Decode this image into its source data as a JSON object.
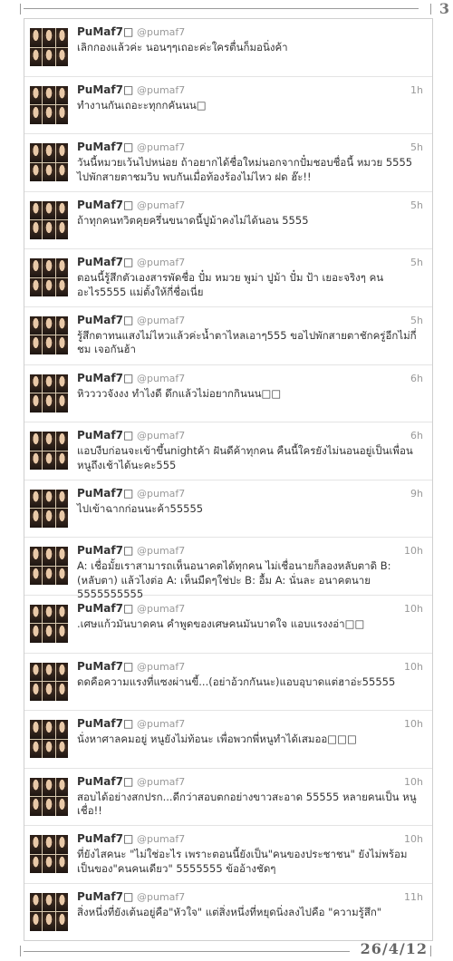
{
  "page": {
    "number": "3",
    "date": "26/4/12"
  },
  "tweets": [
    {
      "name": "PuMaf7□",
      "handle": "@pumaf7",
      "time": "",
      "text": "เลิกกองแล้วค่ะ นอนๆๆเถอะค่ะใครตื่นก็มอนิ่งค้า"
    },
    {
      "name": "PuMaf7□",
      "handle": "@pumaf7",
      "time": "1h",
      "text": "ทำงานกันเถอะะทุกกคันนน□"
    },
    {
      "name": "PuMaf7□",
      "handle": "@pumaf7",
      "time": "5h",
      "text": "วันนี้หมวยเว้นไปหน่อย ถ้าอยากได้ชื่อใหม่นอกจากปั๋มชอบชื่อนี้ หมวย 5555 ไปพักสายตาชมวิบ พบกันเมื่อท้องร้องไม่ไหว ฝด ฮ๊ะ!!"
    },
    {
      "name": "PuMaf7□",
      "handle": "@pumaf7",
      "time": "5h",
      "text": "ถ้าทุกคนทวิตคุยครึ่นขนาดนี้ปูม้าคงไม่ได้นอน 5555"
    },
    {
      "name": "PuMaf7□",
      "handle": "@pumaf7",
      "time": "5h",
      "text": "ตอนนี้รู้สึกตัวเองสารพัดชื่อ ปั๋ม หมวย พูม่า ปูม้า ปั๋ม ป้า เยอะจริงๆ คน อะไร5555 แม่ตั้งให้กี่ชื่อเนี่ย"
    },
    {
      "name": "PuMaf7□",
      "handle": "@pumaf7",
      "time": "5h",
      "text": "รู้สึกตาทนแสงไม่ไหวแล้วค่ะน้ำตาไหลเอาๆ555 ขอไปพักสายตาชักครู่อีกไม่กี่ ชม เจอกันฮ้า"
    },
    {
      "name": "PuMaf7□",
      "handle": "@pumaf7",
      "time": "6h",
      "text": "หิววววจังงง ทำไงดี ดึกแล้วไม่อยากกินนน□□"
    },
    {
      "name": "PuMaf7□",
      "handle": "@pumaf7",
      "time": "6h",
      "text": "แอบงีบก่อนจะเข้าขึ้นnightค้า ฝันดีค้าทุกคน คืนนี้ใครยังไม่นอนอยู่เป็นเพื่อน หนูถึงเช้าได้นะคะ555"
    },
    {
      "name": "PuMaf7□",
      "handle": "@pumaf7",
      "time": "9h",
      "text": "ไปเข้าฉากก่อนนะค้า55555"
    },
    {
      "name": "PuMaf7□",
      "handle": "@pumaf7",
      "time": "10h",
      "text": "A: เชื่อมั้ยเราสามารถเห็นอนาคตได้ทุกคน ไม่เชื่อนายก็ลองหลับตาดิ B: (หลับตา) แล้วไงต่อ A: เห็นมืดๆใช่ปะ B: อื้ม A: นั่นละ อนาคตนาย 5555555555"
    },
    {
      "name": "PuMaf7□",
      "handle": "@pumaf7",
      "time": "10h",
      "text": ".เศษแก้วมันบาดคน คำพูดของเศษคนมันบาดใจ แอบแรงงอ่า□□"
    },
    {
      "name": "PuMaf7□",
      "handle": "@pumaf7",
      "time": "10h",
      "text": "ดดคือความแรงที่แซงผ่านขี้...(อย่าอ้วกกันนะ)แอบอุบาดแต่ฮาอ่ะ55555"
    },
    {
      "name": "PuMaf7□",
      "handle": "@pumaf7",
      "time": "10h",
      "text": "นั่งหาศาลคมอยู่ หนูยังไม่ท้อนะ เพื่อพวกพี่หนูทำได้เสมออ□□□"
    },
    {
      "name": "PuMaf7□",
      "handle": "@pumaf7",
      "time": "10h",
      "text": "สอบได้อย่างสกปรก...ดีกว่าสอบตกอย่างขาวสะอาด 55555 หลายคนเป็น หนูเชื่อ!!"
    },
    {
      "name": "PuMaf7□",
      "handle": "@pumaf7",
      "time": "10h",
      "text": "ที่ยังไสคนะ \"ไม่ใช่อะไร เพราะตอนนี้ยังเป็น\"คนของประชาชน\" ยังไม่พร้อมเป็นของ\"คนคนเดียว\" 5555555 ข้ออ้างชัดๆ"
    },
    {
      "name": "PuMaf7□",
      "handle": "@pumaf7",
      "time": "11h",
      "text": "สิ่งหนึ่งที่ยังเต้นอยู่คือ\"หัวใจ\" แต่สิ่งหนึ่งที่หยุดนิ่งลงไปคือ \"ความรู้สึก\""
    }
  ]
}
